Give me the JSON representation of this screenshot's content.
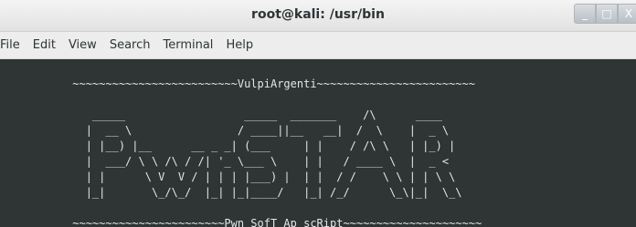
{
  "window": {
    "title": "root@kali: /usr/bin"
  },
  "window_buttons": {
    "minimize": "_",
    "maximize": "□",
    "close": "X"
  },
  "menubar": {
    "items": [
      "File",
      "Edit",
      "View",
      "Search",
      "Terminal",
      "Help"
    ]
  },
  "terminal": {
    "lines": [
      "",
      "          ~~~~~~~~~~~~~~~~~~~~~~~~~VulpiArgenti~~~~~~~~~~~~~~~~~~~~~~~~",
      "",
      "             _____                  _____  _______    /\\      ____",
      "            |  __ \\                / ____||__   __|  /  \\    |  _ \\",
      "            | |__) |__      __ _ _| (___     | |    / /\\ \\   | |_) |",
      "            |  ___/ \\ \\ /\\ / /| '_ \\___ \\    | |   / ____ \\  |  _ <",
      "            | |      \\ V  V / | | | |___) |  | |  / /    \\ \\ | | \\ \\",
      "            |_|       \\_/\\_/  |_| |_|____/   |_| /_/      \\_\\|_|  \\_\\",
      "",
      "          ~~~~~~~~~~~~~~~~~~~~~~~Pwn_SofT_Ap_scRipt~~~~~~~~~~~~~~~~~~~~~"
    ]
  }
}
